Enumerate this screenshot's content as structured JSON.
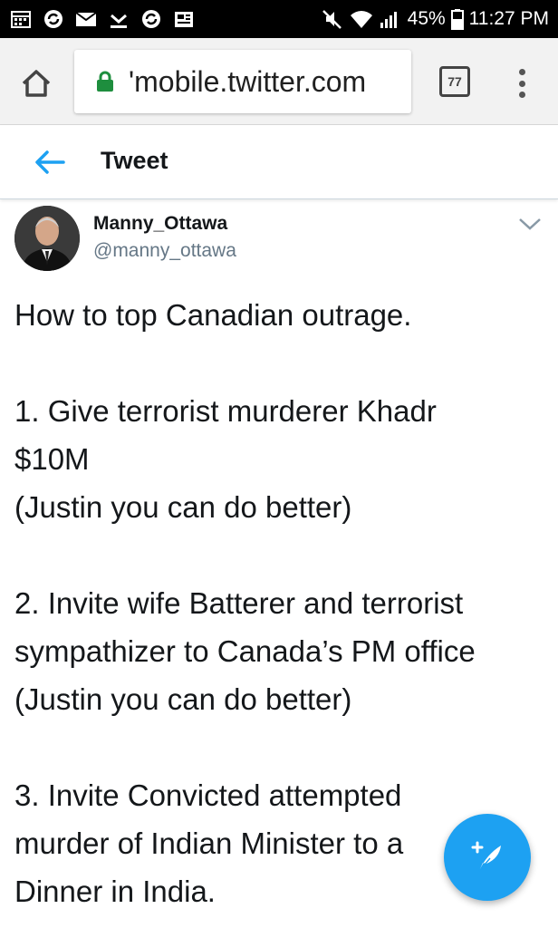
{
  "status_bar": {
    "battery": "45%",
    "time": "11:27 PM",
    "left_icons": [
      "calendar-icon",
      "sync-icon",
      "email-icon",
      "download-icon",
      "sync-icon",
      "news-icon"
    ],
    "right_icons": [
      "mute-icon",
      "wifi-icon",
      "signal-icon",
      "battery-icon"
    ]
  },
  "browser": {
    "url": "'mobile.twitter.com",
    "tab_count": "77",
    "lock_color": "#1e8e3e"
  },
  "header": {
    "title": "Tweet"
  },
  "tweet": {
    "display_name": "Manny_Ottawa",
    "handle": "@manny_ottawa",
    "lines": [
      "How to top Canadian outrage.",
      "",
      "1. Give terrorist murderer Khadr",
      "$10M",
      "(Justin you can do better)",
      "",
      "2. Invite wife Batterer and terrorist",
      "sympathizer to Canada’s PM office",
      "(Justin you can do better)",
      "",
      "3. Invite Convicted attempted",
      "murder of Indian Minister to a",
      "Dinner in India."
    ]
  },
  "colors": {
    "accent": "#1da1f2",
    "handle_gray": "#657786"
  }
}
